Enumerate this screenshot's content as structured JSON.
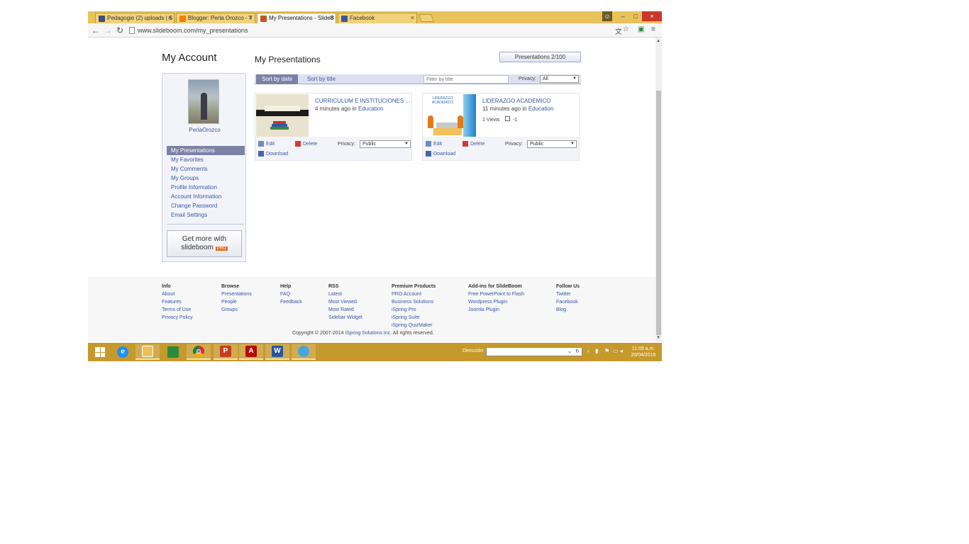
{
  "browser": {
    "tabs": [
      {
        "label": "Pedagogie (2) uploads | S",
        "favicon_color": "#3d4f7a"
      },
      {
        "label": "Blogger: Perla Orozco - T",
        "favicon_color": "#f57d00"
      },
      {
        "label": "My Presentations - SlideB",
        "favicon_color": "#c4541d"
      },
      {
        "label": "Facebook",
        "favicon_color": "#3b5998"
      }
    ],
    "close_glyph": "×",
    "url": "www.slideboom.com/my_presentations",
    "window_buttons": {
      "user": "☺",
      "minimize": "–",
      "maximize": "□",
      "close": "×"
    }
  },
  "page": {
    "account_title": "My Account",
    "presentations_title": "My Presentations",
    "quota": "Presentations 2/100",
    "user": {
      "name": "PerlaOrozco"
    },
    "sidebar_items": [
      "My Presentations",
      "My Favorites",
      "My Comments",
      "My Groups",
      "Profile Information",
      "Account Information",
      "Change Password",
      "Email Settings"
    ],
    "get_pro": {
      "line1": "Get more with",
      "brand": "slideboom",
      "badge": "PRO"
    },
    "sort": {
      "by_date": "Sort by date",
      "by_title": "Sort by title",
      "filter_placeholder": "Filter by title",
      "privacy_label": "Privacy:",
      "privacy_value": "All"
    },
    "presentations": [
      {
        "title": "CURRICULUM E INSTITUCIONES ...",
        "time": "4 minutes ago",
        "in_text": "in",
        "category": "Education",
        "views": "",
        "edit": "Edit",
        "delete": "Delete",
        "privacy_label": "Privacy:",
        "privacy_value": "Public",
        "download": "Download"
      },
      {
        "title": "LIDERAZGO ACADEMICO",
        "time": "11 minutes ago",
        "in_text": "in",
        "category": "Education",
        "views": "1 Views",
        "comments": "-1",
        "thumb_text": "LIDERAZGO ACADEMICO",
        "edit": "Edit",
        "delete": "Delete",
        "privacy_label": "Privacy:",
        "privacy_value": "Public",
        "download": "Download"
      }
    ]
  },
  "footer": {
    "columns": [
      {
        "heading": "Info",
        "links": [
          "About",
          "Features",
          "Terms of Use",
          "Privacy Policy"
        ]
      },
      {
        "heading": "Browse",
        "links": [
          "Presentations",
          "People",
          "Groups"
        ]
      },
      {
        "heading": "Help",
        "links": [
          "FAQ",
          "Feedback"
        ]
      },
      {
        "heading": "RSS",
        "links": [
          "Latest",
          "Most Viewed",
          "Most Rated",
          "Sidebar Widget"
        ]
      },
      {
        "heading": "Premium Products",
        "links": [
          "PRO Account",
          "Business Solutions",
          "iSpring Pro",
          "iSpring Suite",
          "iSpring QuizMaker"
        ]
      },
      {
        "heading": "Add-ins for SlideBoom",
        "links": [
          "Free PowerPoint to Flash",
          "Wordpress Plugin",
          "Joomla Plugin"
        ]
      },
      {
        "heading": "Follow Us",
        "links": [
          "Twitter",
          "Facebook",
          "Blog"
        ]
      }
    ],
    "copyright": "Copyright © 2007-2014",
    "company": "iSpring Solutions Inc.",
    "rights": "All rights reserved."
  },
  "taskbar": {
    "address_label": "Dirección",
    "time": "11:09 a.m.",
    "date": "20/04/2016",
    "apps": [
      {
        "icon": "ie-icon",
        "color": "#1e90ff",
        "glyph": "e"
      },
      {
        "icon": "folder-icon",
        "color": "#e9c25a",
        "glyph": ""
      },
      {
        "icon": "store-icon",
        "color": "#2b8a3e",
        "glyph": ""
      },
      {
        "icon": "chrome-icon",
        "color": "#d93025",
        "glyph": ""
      },
      {
        "icon": "powerpoint-icon",
        "color": "#c43e1c",
        "glyph": "P"
      },
      {
        "icon": "acrobat-icon",
        "color": "#b30b00",
        "glyph": "A"
      },
      {
        "icon": "word-icon",
        "color": "#2b579a",
        "glyph": "W"
      },
      {
        "icon": "paint-icon",
        "color": "#4aa3df",
        "glyph": ""
      }
    ]
  }
}
